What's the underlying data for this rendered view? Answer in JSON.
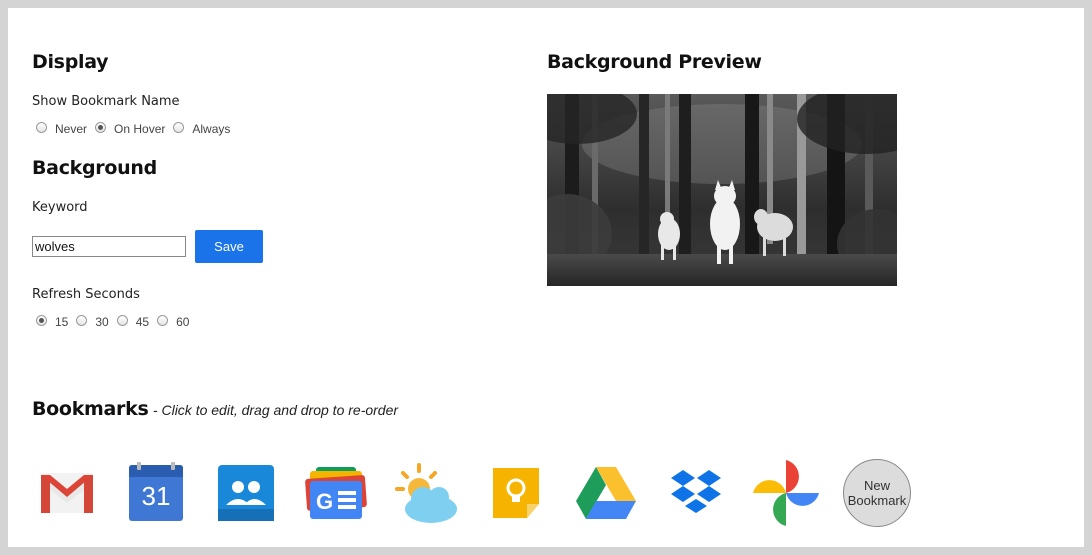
{
  "display": {
    "heading": "Display",
    "show_bookmark_name_label": "Show Bookmark Name",
    "options": [
      "Never",
      "On Hover",
      "Always"
    ],
    "selected": "On Hover"
  },
  "background": {
    "heading": "Background",
    "keyword_label": "Keyword",
    "keyword_value": "wolves",
    "save_label": "Save",
    "refresh_label": "Refresh Seconds",
    "refresh_options": [
      "15",
      "30",
      "45",
      "60"
    ],
    "refresh_selected": "15"
  },
  "preview": {
    "heading": "Background Preview",
    "image_subject": "wolves in forest (grayscale)"
  },
  "bookmarks": {
    "heading": "Bookmarks",
    "subheading": "- Click to edit, drag and drop to re-order",
    "items": [
      {
        "icon": "gmail-icon"
      },
      {
        "icon": "calendar-icon",
        "text": "31"
      },
      {
        "icon": "contacts-icon"
      },
      {
        "icon": "google-news-icon"
      },
      {
        "icon": "weather-icon"
      },
      {
        "icon": "keep-icon"
      },
      {
        "icon": "drive-icon"
      },
      {
        "icon": "dropbox-icon"
      },
      {
        "icon": "photos-icon"
      }
    ],
    "new_label_line1": "New",
    "new_label_line2": "Bookmark"
  },
  "colors": {
    "accent": "#1a73e8",
    "page_bg": "#d4d4d4"
  }
}
